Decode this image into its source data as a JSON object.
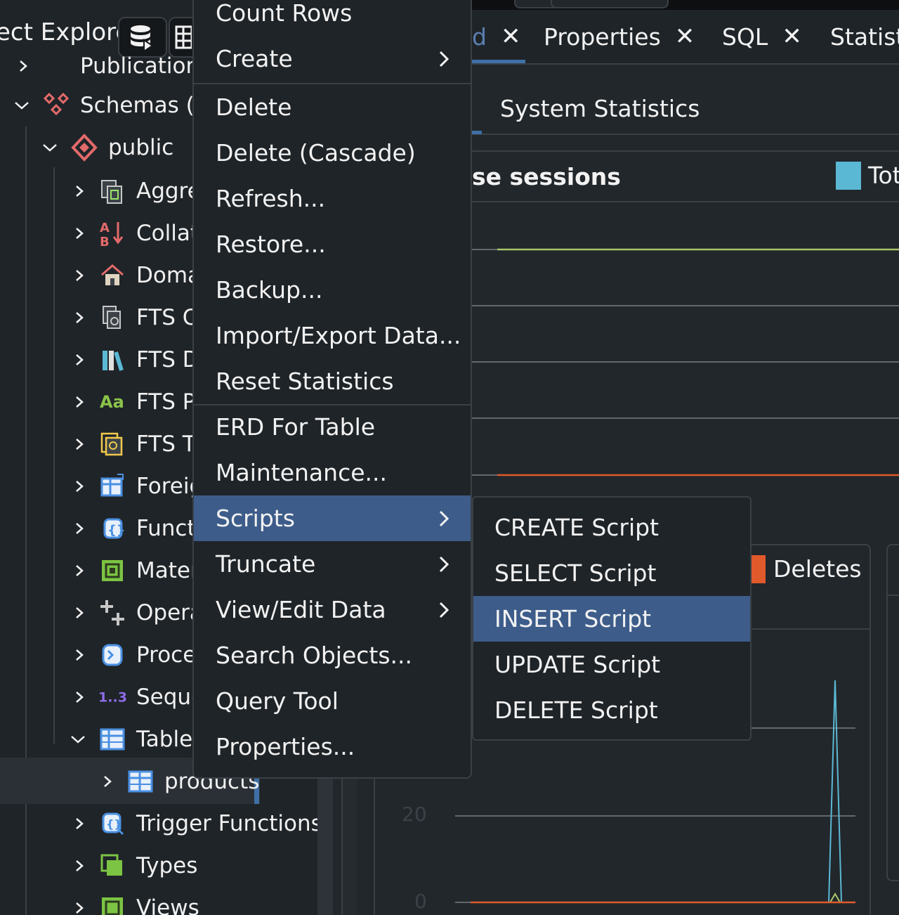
{
  "object_explorer": {
    "title": "ect Explorer",
    "tree": [
      {
        "label": "Publication",
        "icon": "publication-icon",
        "expanded": false
      },
      {
        "label": "Schemas (",
        "icon": "schemas-icon",
        "expanded": true
      },
      {
        "label": "public",
        "icon": "schema-icon",
        "expanded": true
      },
      {
        "label": "Aggre",
        "icon": "aggregate-icon",
        "expanded": false
      },
      {
        "label": "Collat",
        "icon": "collation-icon",
        "expanded": false
      },
      {
        "label": "Doma",
        "icon": "domain-icon",
        "expanded": false
      },
      {
        "label": "FTS C",
        "icon": "fts-configuration-icon",
        "expanded": false
      },
      {
        "label": "FTS D",
        "icon": "fts-dictionary-icon",
        "expanded": false
      },
      {
        "label": "FTS P",
        "icon": "fts-parser-icon",
        "expanded": false
      },
      {
        "label": "FTS T",
        "icon": "fts-template-icon",
        "expanded": false
      },
      {
        "label": "Foreig",
        "icon": "foreign-table-icon",
        "expanded": false
      },
      {
        "label": "Funct",
        "icon": "function-icon",
        "expanded": false
      },
      {
        "label": "Mater",
        "icon": "materialized-view-icon",
        "expanded": false
      },
      {
        "label": "Opera",
        "icon": "operator-icon",
        "expanded": false
      },
      {
        "label": "Proce",
        "icon": "procedure-icon",
        "expanded": false
      },
      {
        "label": "Seque",
        "icon": "sequence-icon",
        "expanded": false
      },
      {
        "label": "Table",
        "icon": "table-icon",
        "expanded": true
      },
      {
        "label": "products",
        "icon": "table-icon",
        "expanded": false
      },
      {
        "label": "Trigger Functions",
        "icon": "trigger-function-icon",
        "expanded": false
      },
      {
        "label": "Types",
        "icon": "type-icon",
        "expanded": false
      },
      {
        "label": "Views",
        "icon": "view-icon",
        "expanded": false
      }
    ]
  },
  "tabs": [
    {
      "label": "d",
      "closable": true
    },
    {
      "label": "Properties",
      "closable": true
    },
    {
      "label": "SQL",
      "closable": true
    },
    {
      "label": "Statist",
      "closable": false
    }
  ],
  "sub_tab": {
    "label": "System Statistics"
  },
  "dashboard": {
    "sessions_title": "se sessions",
    "legend_total": "Tot",
    "legend_deletes": "Deletes",
    "y_ticks": [
      "20",
      "0"
    ],
    "colors": {
      "total": "#5bb8d4",
      "active": "#a8c66c",
      "idle": "#e05a2b",
      "deletes": "#e05a2b"
    }
  },
  "context_menu": {
    "items": [
      {
        "label": "Count Rows",
        "has_submenu": false
      },
      {
        "label": "Create",
        "has_submenu": true
      },
      {
        "label": "Delete",
        "has_submenu": false
      },
      {
        "label": "Delete (Cascade)",
        "has_submenu": false
      },
      {
        "label": "Refresh...",
        "has_submenu": false
      },
      {
        "label": "Restore...",
        "has_submenu": false
      },
      {
        "label": "Backup...",
        "has_submenu": false
      },
      {
        "label": "Import/Export Data...",
        "has_submenu": false
      },
      {
        "label": "Reset Statistics",
        "has_submenu": false
      },
      {
        "label": "ERD For Table",
        "has_submenu": false
      },
      {
        "label": "Maintenance...",
        "has_submenu": false
      },
      {
        "label": "Scripts",
        "has_submenu": true,
        "active": true
      },
      {
        "label": "Truncate",
        "has_submenu": true
      },
      {
        "label": "View/Edit Data",
        "has_submenu": true
      },
      {
        "label": "Search Objects...",
        "has_submenu": false
      },
      {
        "label": "Query Tool",
        "has_submenu": false
      },
      {
        "label": "Properties...",
        "has_submenu": false
      }
    ]
  },
  "scripts_submenu": {
    "items": [
      {
        "label": "CREATE Script"
      },
      {
        "label": "SELECT Script"
      },
      {
        "label": "INSERT Script",
        "active": true
      },
      {
        "label": "UPDATE Script"
      },
      {
        "label": "DELETE Script"
      }
    ]
  }
}
